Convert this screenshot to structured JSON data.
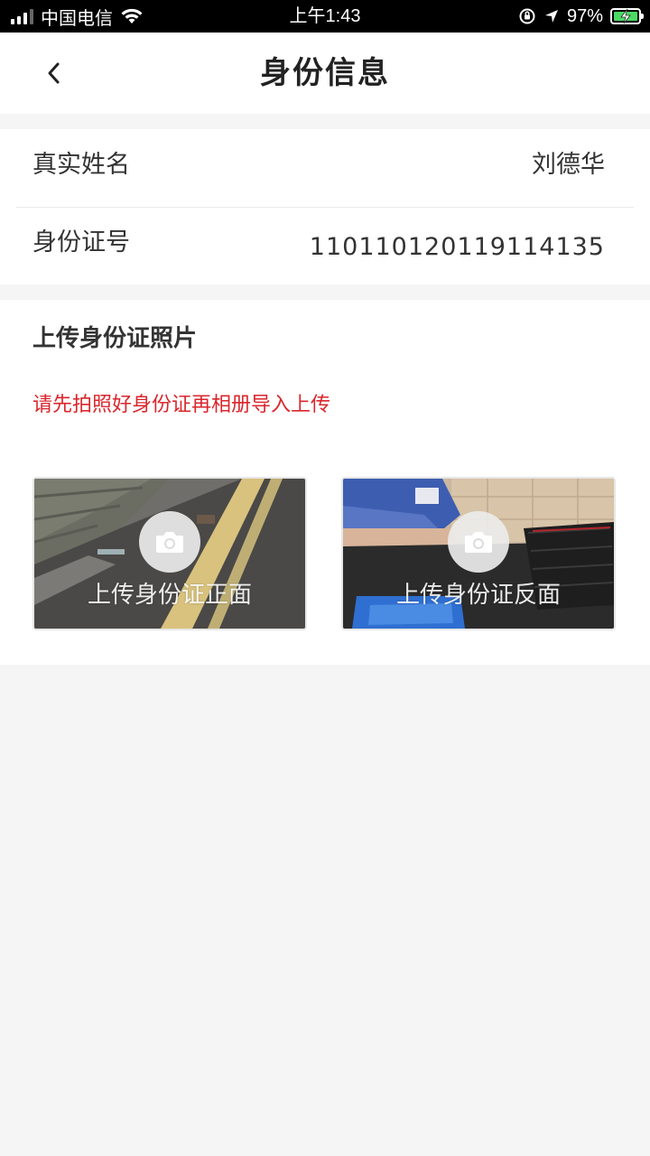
{
  "status_bar": {
    "carrier": "中国电信",
    "time": "上午1:43",
    "battery": "97%"
  },
  "nav": {
    "title": "身份信息",
    "back_icon": "chevron-left-icon"
  },
  "info": {
    "rows": [
      {
        "label": "真实姓名",
        "value": "刘德华"
      },
      {
        "label": "身份证号",
        "value": "110110120119114135"
      }
    ]
  },
  "upload": {
    "title": "上传身份证照片",
    "hint": "请先拍照好身份证再相册导入上传",
    "hint_color": "#d9262c",
    "cards": [
      {
        "label": "上传身份证正面",
        "icon": "camera-icon"
      },
      {
        "label": "上传身份证反面",
        "icon": "camera-icon"
      }
    ]
  },
  "colors": {
    "page_bg": "#f5f5f5",
    "card_bg": "#ffffff",
    "battery_fill": "#4cd964"
  }
}
